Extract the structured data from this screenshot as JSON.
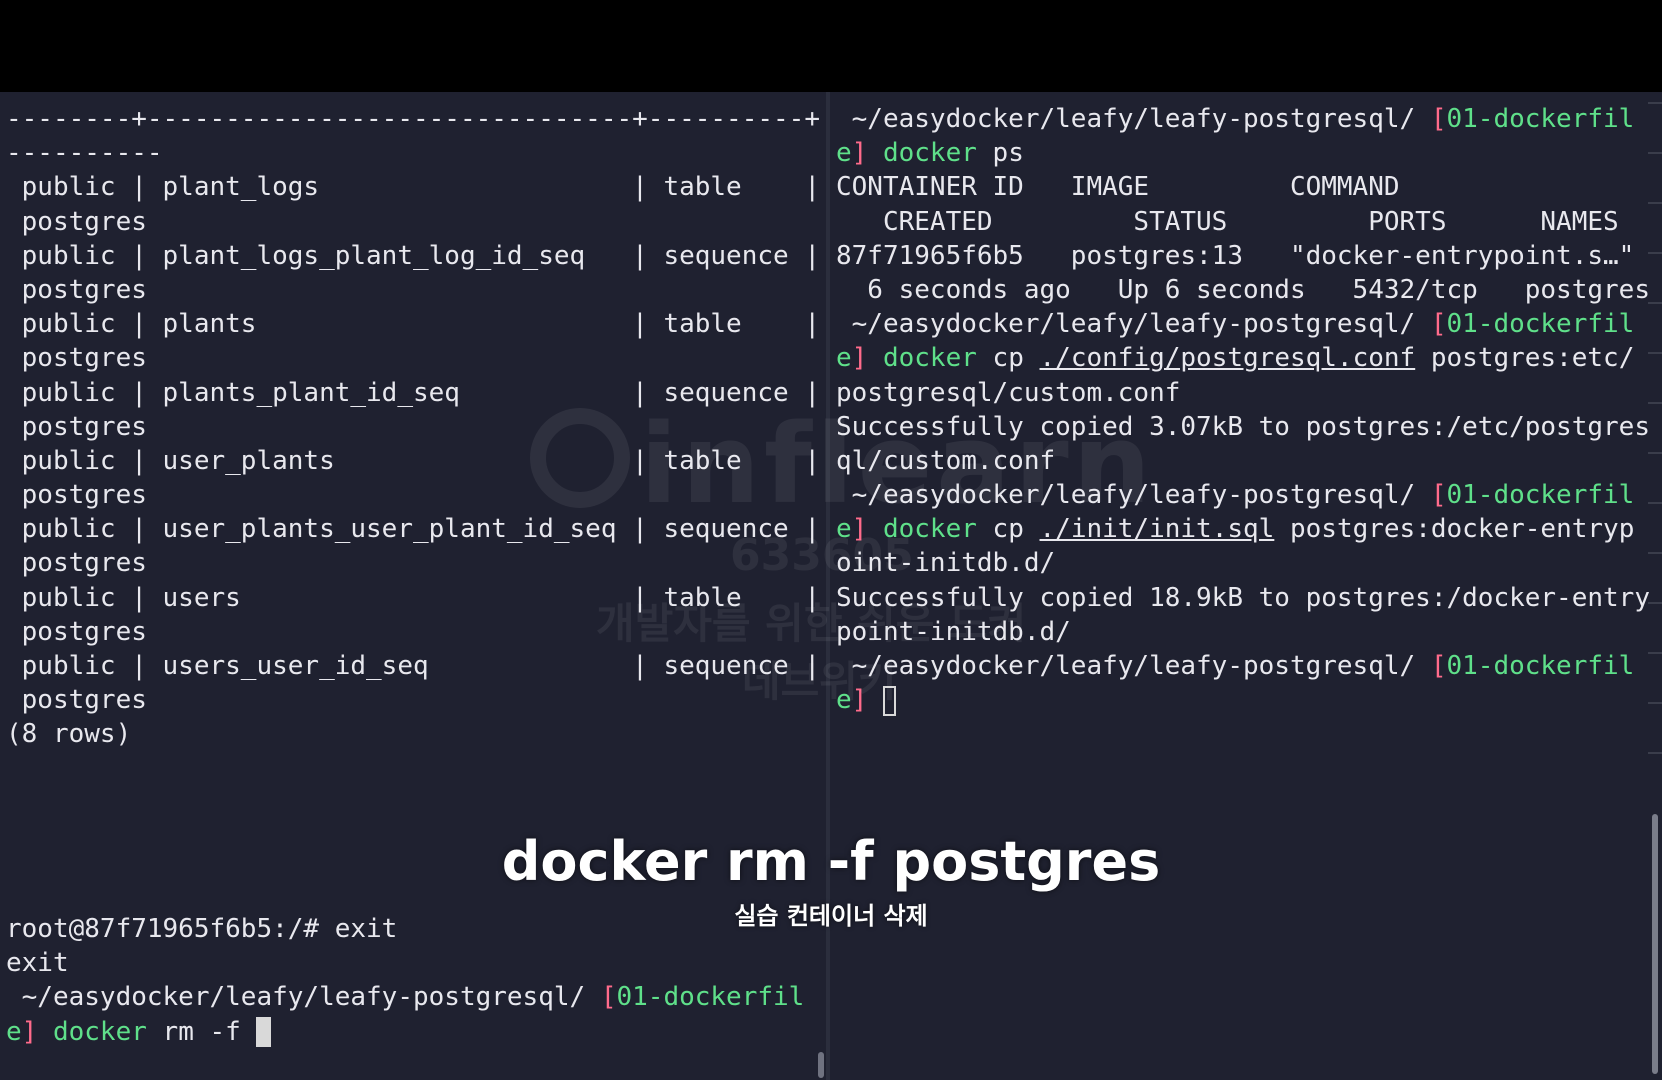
{
  "left_pane": {
    "top_lines": [
      "--------+-------------------------------+----------+",
      "----------",
      " public | plant_logs                    | table    |",
      " postgres",
      " public | plant_logs_plant_log_id_seq   | sequence |",
      " postgres",
      " public | plants                        | table    |",
      " postgres",
      " public | plants_plant_id_seq           | sequence |",
      " postgres",
      " public | user_plants                   | table    |",
      " postgres",
      " public | user_plants_user_plant_id_seq | sequence |",
      " postgres",
      " public | users                         | table    |",
      " postgres",
      " public | users_user_id_seq             | sequence |",
      " postgres",
      "(8 rows)"
    ],
    "exit_command": "root@87f71965f6b5:/# exit",
    "exit_output": "exit",
    "prompt": {
      "apple": "",
      "path": " ~/easydocker/leafy/leafy-postgresql/ ",
      "open_bracket": "[",
      "branch_part1": "01-dockerfil",
      "branch_part2": "e",
      "close_bracket": "]",
      "cmd": "docker",
      "args": " rm -f "
    }
  },
  "right_pane": {
    "prompt_path": " ~/easydocker/leafy/leafy-postgresql/ ",
    "open_bracket": "[",
    "branch_part1": "01-dockerfil",
    "branch_part2": "e",
    "close_bracket": "]",
    "apple": "",
    "cmd": "docker",
    "cmd1_args": " ps",
    "ps_header1": "CONTAINER ID   IMAGE         COMMAND",
    "ps_header2": "   CREATED         STATUS         PORTS      NAMES",
    "ps_row1": "87f71965f6b5   postgres:13   \"docker-entrypoint.s…\"",
    "ps_row2": "  6 seconds ago   Up 6 seconds   5432/tcp   postgres",
    "cmd2_pre": " cp ",
    "cmd2_src": "./config/postgresql.conf",
    "cmd2_post": " postgres:etc/",
    "cmd2_wrap": "postgresql/custom.conf",
    "cmd2_out1": "Successfully copied 3.07kB to postgres:/etc/postgres",
    "cmd2_out2": "ql/custom.conf",
    "cmd3_pre": " cp ",
    "cmd3_src": "./init/init.sql",
    "cmd3_post": " postgres:docker-entryp",
    "cmd3_wrap": "oint-initdb.d/",
    "cmd3_out1": "Successfully copied 18.9kB to postgres:/docker-entry",
    "cmd3_out2": "point-initdb.d/"
  },
  "watermark": {
    "logo": "inflearn",
    "number": "633605",
    "line1": "개발자를 위한 쉬운 도커",
    "line2": "데브위키"
  },
  "caption": {
    "main": "docker rm -f postgres",
    "sub": "실습 컨테이너 삭제"
  }
}
